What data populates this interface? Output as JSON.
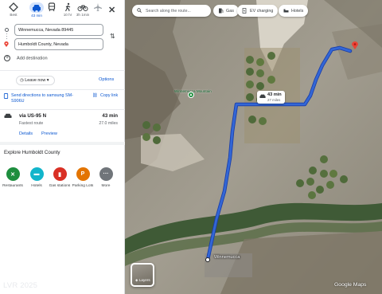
{
  "travel_modes": [
    {
      "name": "car",
      "label": "43 min",
      "active": true
    },
    {
      "name": "transit",
      "label": "",
      "active": false
    },
    {
      "name": "walk",
      "label": "10 hr",
      "active": false
    },
    {
      "name": "bike",
      "label": "3h 1min",
      "active": false
    },
    {
      "name": "flight",
      "label": "",
      "active": false
    }
  ],
  "mode_labels": {
    "best": "Best"
  },
  "origin": "Winnemucca, Nevada 89445",
  "destination": "Humboldt County, Nevada",
  "add_destination": "Add destination",
  "leave_now": "Leave now",
  "options": "Options",
  "send_directions": "Send directions to samsung SM-S906U",
  "copy_link": "Copy link",
  "route": {
    "via": "via US-95 N",
    "subtitle": "Fastest route",
    "time": "43 min",
    "distance": "27.0 miles",
    "details": "Details",
    "preview": "Preview"
  },
  "explore": {
    "heading": "Explore Humboldt County",
    "categories": [
      {
        "label": "Restaurants",
        "color": "#1e8e3e",
        "icon": "fork-knife-icon"
      },
      {
        "label": "Hotels",
        "color": "#12b5cb",
        "icon": "bed-icon"
      },
      {
        "label": "Gas stations",
        "color": "#d93025",
        "icon": "gas-pump-icon"
      },
      {
        "label": "Parking Lots",
        "color": "#e37400",
        "icon": "parking-icon"
      },
      {
        "label": "More",
        "color": "#70757a",
        "icon": "more-dots-icon"
      }
    ]
  },
  "map": {
    "search_placeholder": "Search along the route...",
    "chips": [
      "Gas",
      "EV charging",
      "Hotels"
    ],
    "route_time": "43 min",
    "route_distance": "27 miles",
    "poi_label": "Winnemucca Mountain",
    "town_label": "Winnemucca",
    "layers_label": "Layers",
    "attribution": "Google Maps",
    "route_color": "#3367d6"
  },
  "watermark": "LVR 2025"
}
